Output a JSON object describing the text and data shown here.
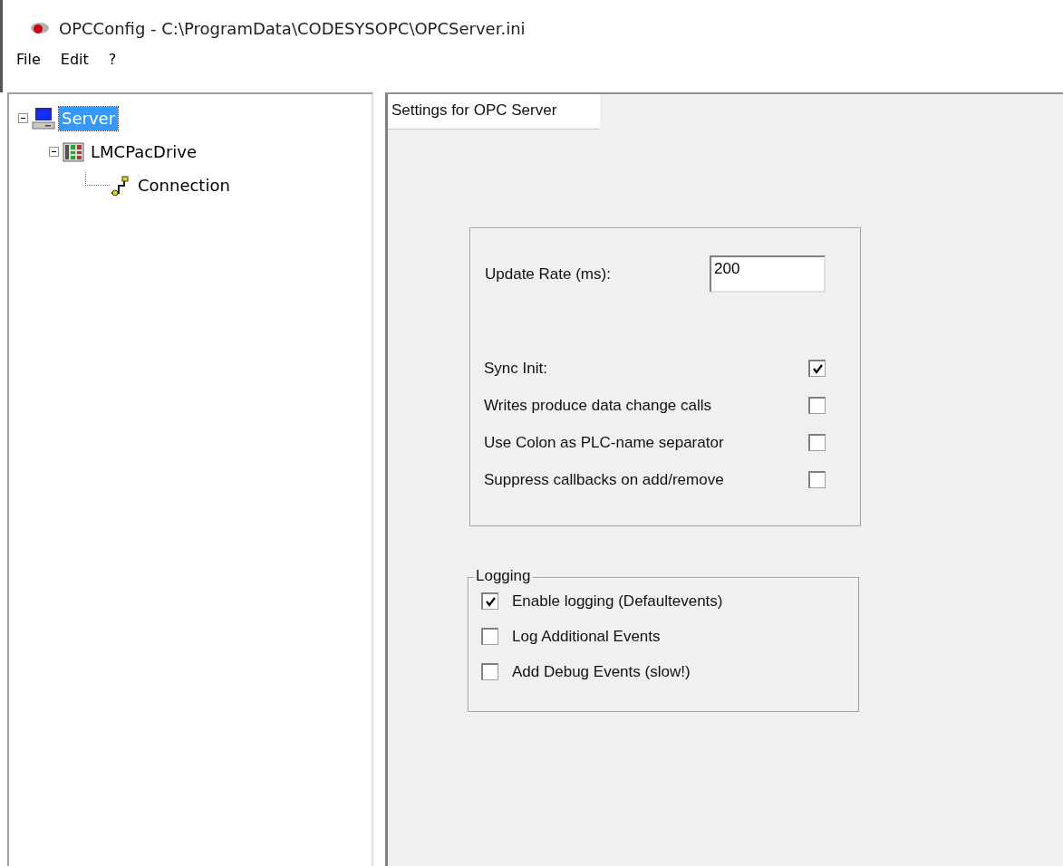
{
  "window": {
    "title": "OPCConfig - C:\\ProgramData\\CODESYSOPC\\OPCServer.ini"
  },
  "menu": [
    "File",
    "Edit",
    "?"
  ],
  "tree": [
    {
      "label": "Server",
      "kind": "computer",
      "selected": true,
      "expanded": true,
      "children": [
        {
          "label": "LMCPacDrive",
          "kind": "plc",
          "selected": false,
          "expanded": true,
          "children": [
            {
              "label": "Connection",
              "kind": "connection",
              "selected": false
            }
          ]
        }
      ]
    }
  ],
  "panel": {
    "header": "Settings for OPC Server",
    "update_rate": {
      "label": "Update Rate (ms):",
      "value": "200"
    },
    "options": [
      {
        "label": "Sync Init:",
        "checked": true
      },
      {
        "label": "Writes produce data change calls",
        "checked": false
      },
      {
        "label": "Use Colon as PLC-name separator",
        "checked": false
      },
      {
        "label": "Suppress callbacks on add/remove",
        "checked": false
      }
    ],
    "logging": {
      "title": "Logging",
      "options": [
        {
          "label": "Enable logging (Defaultevents)",
          "checked": true
        },
        {
          "label": "Log Additional Events",
          "checked": false
        },
        {
          "label": "Add Debug Events (slow!)",
          "checked": false
        }
      ]
    }
  }
}
